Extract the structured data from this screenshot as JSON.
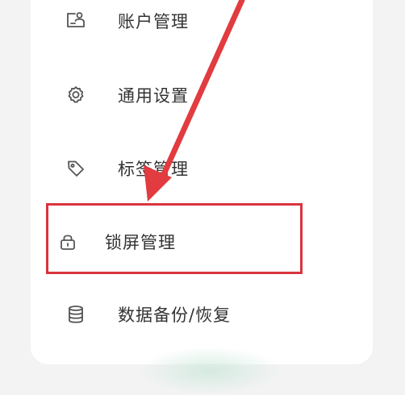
{
  "menu": {
    "items": [
      {
        "id": "account",
        "label": "账户管理",
        "icon": "account-card-icon"
      },
      {
        "id": "general",
        "label": "通用设置",
        "icon": "gear-icon"
      },
      {
        "id": "tags",
        "label": "标签管理",
        "icon": "tag-icon"
      },
      {
        "id": "lock",
        "label": "锁屏管理",
        "icon": "lock-icon"
      },
      {
        "id": "backup",
        "label": "数据备份/恢复",
        "icon": "database-icon"
      }
    ]
  },
  "colors": {
    "icon": "#555555",
    "text": "#333333",
    "annotation": "#d9343d",
    "background": "#f3f3f4",
    "card": "#ffffff"
  }
}
